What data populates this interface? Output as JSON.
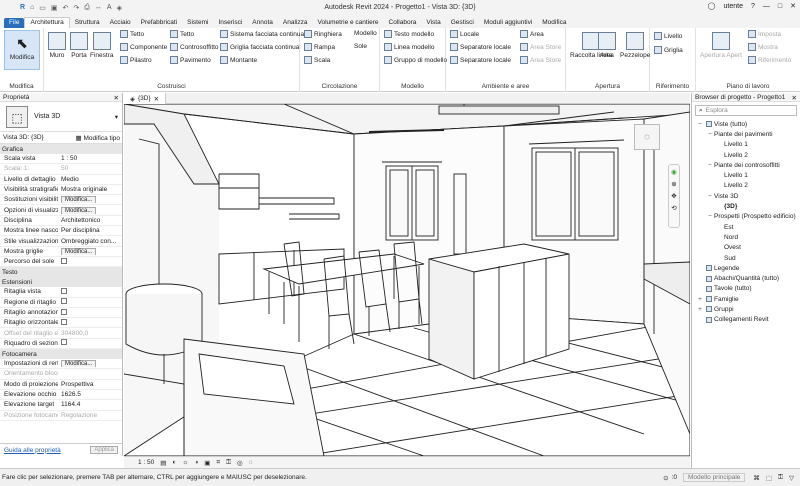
{
  "app": {
    "title": "Autodesk Revit 2024 - Progetto1 - Vista 3D: {3D}",
    "user": "utente"
  },
  "tabs": [
    "File",
    "Architettura",
    "Struttura",
    "Acciaio",
    "Prefabbricati",
    "Sistemi",
    "Inserisci",
    "Annota",
    "Analizza",
    "Volumetrie e cantiere",
    "Collabora",
    "Vista",
    "Gestisci",
    "Moduli aggiuntivi",
    "Modifica"
  ],
  "ribbon": {
    "modifica": {
      "label": "Modifica",
      "group": "Modifica"
    },
    "costruisci": {
      "big": [
        "Muro",
        "Porta",
        "Finestra"
      ],
      "col1": [
        "Tetto",
        "Componente",
        "Pilastro"
      ],
      "col2": [
        "Tetto",
        "Controsoffitto",
        "Pavimento"
      ],
      "col3": [
        "Sistema facciata continua",
        "Griglia facciata continua",
        "Montante"
      ],
      "group": "Costruisci"
    },
    "circolazione": {
      "items": [
        "Ringhiera",
        "Rampa",
        "Scala"
      ],
      "extra": [
        "Modello",
        "Sole"
      ],
      "group": "Circolazione"
    },
    "modello": {
      "items": [
        "Testo modello",
        "Linea modello",
        "Gruppo di modello"
      ],
      "group": "Modello"
    },
    "ambiente": {
      "col1": [
        "Locale",
        "Separatore locale",
        "Separatore locale"
      ],
      "col2": [
        "Area",
        "Area Store",
        "Area Store"
      ],
      "group": "Ambiente e aree"
    },
    "apertura": {
      "items": [
        "Raccolta limita",
        "Area",
        "Pezzelope"
      ],
      "group": "Apertura"
    },
    "riferimento": {
      "items": [
        "Livello",
        "Griglia"
      ],
      "group": "Riferimento"
    },
    "piano": {
      "items": [
        "Apertura Apert",
        "Imposta",
        "Mostra",
        "Riferimento"
      ],
      "group": "Piano di lavoro"
    }
  },
  "properties": {
    "header": "Proprietà",
    "type_name": "Vista 3D",
    "selector": "Vista 3D: {3D}",
    "edit_type": "Modifica tipo",
    "sections": [
      {
        "name": "Grafica",
        "rows": [
          {
            "k": "Scala vista",
            "v": "1 : 50"
          },
          {
            "k": "Scala: 1:",
            "v": "50",
            "dim": true
          },
          {
            "k": "Livello di dettaglio",
            "v": "Medio"
          },
          {
            "k": "Visibilità stratigrafie...",
            "v": "Mostra originale"
          },
          {
            "k": "Sostituzioni visibilità...",
            "v": "Modifica...",
            "btn": true
          },
          {
            "k": "Opzioni di visualizza...",
            "v": "Modifica...",
            "btn": true
          },
          {
            "k": "Disciplina",
            "v": "Architettonico"
          },
          {
            "k": "Mostra linee nascost...",
            "v": "Per disciplina"
          },
          {
            "k": "Stile visualizzazione...",
            "v": "Ombreggiato con..."
          },
          {
            "k": "Mostra griglie",
            "v": "Modifica...",
            "btn": true
          },
          {
            "k": "Percorso del sole",
            "v": "",
            "cb": true
          }
        ]
      },
      {
        "name": "Testo",
        "rows": []
      },
      {
        "name": "Estensioni",
        "rows": [
          {
            "k": "Ritaglia vista",
            "v": "",
            "cb": true
          },
          {
            "k": "Regione di ritaglio vis...",
            "v": "",
            "cb": true
          },
          {
            "k": "Ritaglio annotazione",
            "v": "",
            "cb": true
          },
          {
            "k": "Ritaglio orizzontale a...",
            "v": "",
            "cb": true
          },
          {
            "k": "Offset del ritaglio ent...",
            "v": "304800,0",
            "dim": true
          },
          {
            "k": "Riquadro di sezione",
            "v": "",
            "cb": true
          }
        ]
      },
      {
        "name": "Fotocamera",
        "rows": [
          {
            "k": "Impostazioni di rendi...",
            "v": "Modifica...",
            "btn": true
          },
          {
            "k": "Orientamento bloccato",
            "v": "",
            "dim": true
          },
          {
            "k": "Modo di proiezione",
            "v": "Prospettiva"
          },
          {
            "k": "Elevazione occhio",
            "v": "1626.5"
          },
          {
            "k": "Elevazione target",
            "v": "1164.4"
          },
          {
            "k": "Posizione fotocamera",
            "v": "Regolazione",
            "dim": true
          }
        ]
      }
    ],
    "help_link": "Guida alle proprietà",
    "apply": "Applica"
  },
  "view": {
    "tab": "{3D}",
    "scale": "1 : 50"
  },
  "browser": {
    "header": "Browser di progetto - Progetto1",
    "search_placeholder": "Esplora",
    "tree": [
      {
        "label": "Viste (tutto)",
        "level": 0,
        "toggle": "−"
      },
      {
        "label": "Piante dei pavimenti",
        "level": 1,
        "toggle": "−"
      },
      {
        "label": "Livello 1",
        "level": 2
      },
      {
        "label": "Livello 2",
        "level": 2
      },
      {
        "label": "Piante dei controsoffitti",
        "level": 1,
        "toggle": "−"
      },
      {
        "label": "Livello 1",
        "level": 2
      },
      {
        "label": "Livello 2",
        "level": 2
      },
      {
        "label": "Viste 3D",
        "level": 1,
        "toggle": "−"
      },
      {
        "label": "{3D}",
        "level": 2,
        "bold": true
      },
      {
        "label": "Prospetti (Prospetto edificio)",
        "level": 1,
        "toggle": "−"
      },
      {
        "label": "Est",
        "level": 2
      },
      {
        "label": "Nord",
        "level": 2
      },
      {
        "label": "Ovest",
        "level": 2
      },
      {
        "label": "Sud",
        "level": 2
      },
      {
        "label": "Legende",
        "level": 0,
        "icon": true
      },
      {
        "label": "Abachi/Quantità (tutto)",
        "level": 0,
        "icon": true
      },
      {
        "label": "Tavole (tutto)",
        "level": 0,
        "icon": true
      },
      {
        "label": "Famiglie",
        "level": 0,
        "toggle": "+"
      },
      {
        "label": "Gruppi",
        "level": 0,
        "toggle": "+"
      },
      {
        "label": "Collegamenti Revit",
        "level": 0,
        "icon": true
      }
    ]
  },
  "status": {
    "text": "Fare clic per selezionare, premere TAB per alternare, CTRL per aggiungere e MAIUSC per deselezionare.",
    "model": "Modello principale",
    "zoom": ":0"
  }
}
